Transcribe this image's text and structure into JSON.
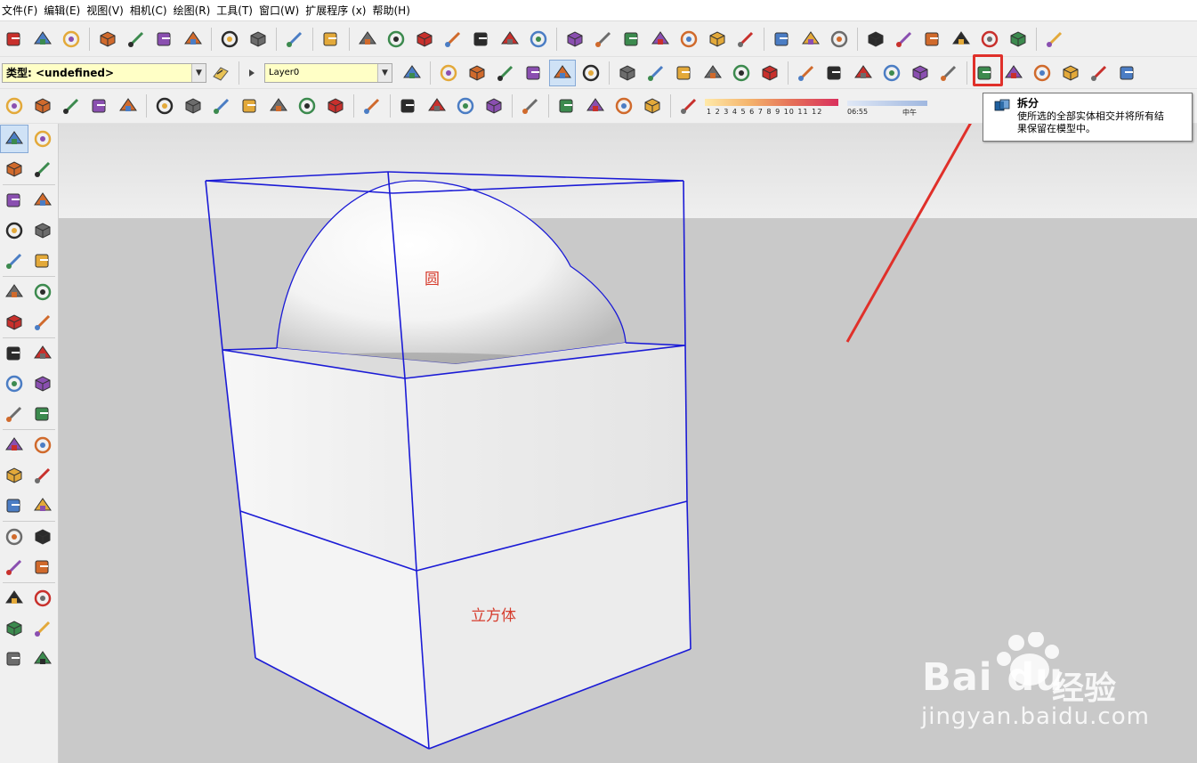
{
  "menu": [
    "文件(F)",
    "编辑(E)",
    "视图(V)",
    "相机(C)",
    "绘图(R)",
    "工具(T)",
    "窗口(W)",
    "扩展程序 (x)",
    "帮助(H)"
  ],
  "entity_info": {
    "type_label": "类型: <undefined>",
    "layer_value": "Layer0"
  },
  "shadow_scale": {
    "ticks": "1 2 3 4 5 6 7 8 9 10 11 12",
    "time_start": "06:55",
    "time_mid": "中午"
  },
  "tooltip": {
    "title": "拆分",
    "line1": "使所选的全部实体相交并将所有结",
    "line2": "果保留在模型中。"
  },
  "canvas": {
    "label_circle": "圆",
    "label_cube": "立方体"
  },
  "watermark": {
    "brand": "Bai  du",
    "brand_cn": "经验",
    "url": "jingyan.baidu.com"
  },
  "colors": {
    "accent_red": "#e0302a",
    "edge_blue": "#1b1bd6",
    "sky": "#e7e7e7",
    "ground": "#c9c9c9",
    "label_red": "#d63c2d"
  },
  "toolbar1_icons": [
    "new-file-icon",
    "open-folder-icon",
    "save-icon",
    "cut-icon",
    "copy-icon",
    "paste-icon",
    "erase-icon",
    "undo-icon",
    "redo-icon",
    "print-icon",
    "model-info-icon",
    "components-icon",
    "photo-textures-icon",
    "download-icon",
    "warehouse-icon",
    "upload-icon",
    "share-icon",
    "extension-icon",
    "camera-icon",
    "position-camera-icon",
    "walk-icon",
    "look-around-icon",
    "section-plane-icon",
    "section-display-icon",
    "delete-red-icon",
    "move-tool-icon",
    "sandbox-1-icon",
    "sandbox-2-icon",
    "sandbox-3-icon",
    "sandbox-4-icon",
    "sandbox-5-icon",
    "sandbox-6-icon",
    "sandbox-7-icon",
    "sandbox-8-icon",
    "export-icon"
  ],
  "toolbar2_icons": [
    "layer-manager-icon",
    "xray-icon",
    "back-edges-icon",
    "wireframe-icon",
    "hidden-line-icon",
    "shaded-icon",
    "shaded-textures-icon",
    "monochrome-icon",
    "iso-view-icon",
    "top-view-icon",
    "front-view-icon",
    "right-view-icon",
    "back-view-icon",
    "left-view-icon",
    "outer-shell-icon",
    "intersect-icon",
    "union-icon",
    "subtract-icon",
    "trim-icon",
    "split-icon",
    "tape-measure-icon",
    "dimension-icon",
    "protractor-icon",
    "text-icon",
    "axes-icon",
    "3d-text-icon"
  ],
  "toolbar3_icons": [
    "section-cut-icon",
    "cube-icon",
    "cube-sub-icon",
    "fog-icon",
    "styles-icon",
    "sandbox-from-contours-icon",
    "sandbox-scratch-icon",
    "smoove-icon",
    "stamp-icon",
    "drape-icon",
    "add-detail-icon",
    "flip-edge-icon",
    "vray-icon",
    "teapot-icon",
    "interactive-icon",
    "cloud-icon",
    "dome-light-icon",
    "mesh-light-icon",
    "frame-icon",
    "printer-icon",
    "layer-icon",
    "lock-icon",
    "shadow-toggle-icon"
  ],
  "left_icons": [
    "select-icon",
    "make-component-icon",
    "paint-bucket-icon",
    "eraser-icon",
    "line-icon",
    "freehand-icon",
    "rectangle-icon",
    "rotated-rectangle-icon",
    "circle-icon",
    "polygon-icon",
    "arc-icon",
    "arc-2pt-icon",
    "arc-3pt-icon",
    "pie-icon",
    "move-icon",
    "push-pull-icon",
    "rotate-icon",
    "follow-me-icon",
    "scale-icon",
    "offset-icon",
    "tape-measure-icon",
    "dimension-icon",
    "protractor-icon",
    "text-icon",
    "axes-icon",
    "3d-text-icon",
    "orbit-icon",
    "pan-icon",
    "zoom-icon",
    "zoom-window-icon",
    "zoom-extents-icon",
    "previous-view-icon",
    "position-camera-icon",
    "look-around-icon",
    "walk-icon",
    "section-plane-icon"
  ]
}
